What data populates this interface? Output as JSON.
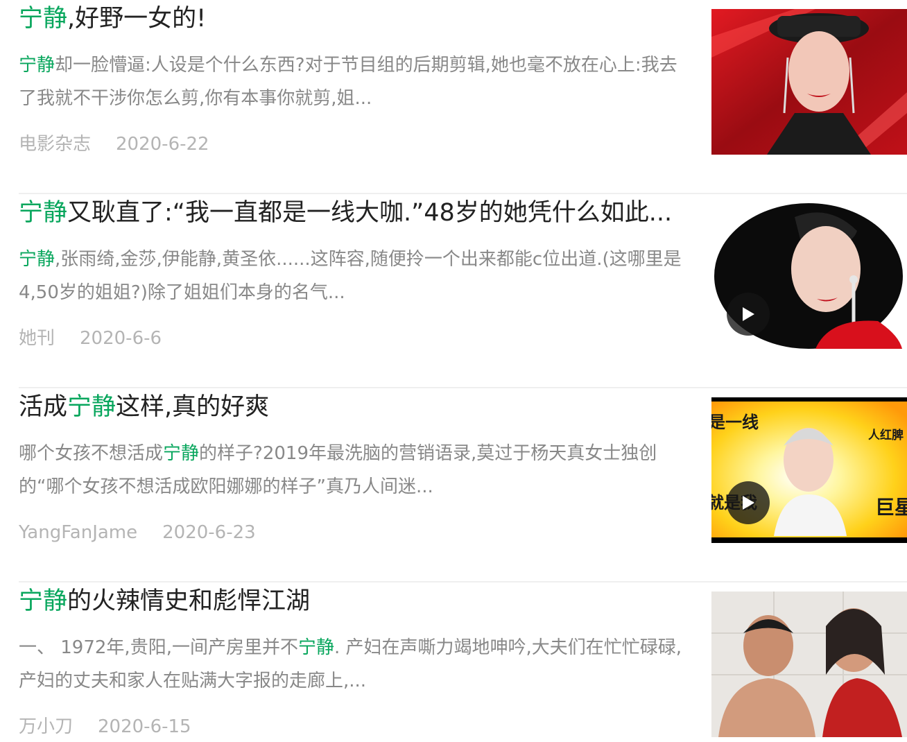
{
  "keyword": "宁静",
  "colors": {
    "highlight": "#07a65c",
    "title": "#222222",
    "summary": "#888888",
    "meta": "#b4b4b4"
  },
  "articles": [
    {
      "title": {
        "hl": "宁静",
        "rest": ",好野一女的!"
      },
      "summary": {
        "hl": "宁静",
        "rest": "却一脸懵逼:人设是个什么东西?对于节目组的后期剪辑,她也毫不放在心上:我去了我就不干涉你怎么剪,你有本事你就剪,姐..."
      },
      "source": "电影杂志",
      "date": "2020-6-22",
      "thumb": {
        "icon": "woman-red-hat-image",
        "has_video": false
      }
    },
    {
      "title": {
        "hl": "宁静",
        "rest": "又耿直了:“我一直都是一线大咖.”48岁的她凭什么如此..."
      },
      "summary": {
        "hl": "宁静",
        "rest": ",张雨绮,金莎,伊能静,黄圣依......这阵容,随便拎一个出来都能c位出道.(这哪里是4,50岁的姐姐?)除了姐姐们本身的名气..."
      },
      "source": "她刊",
      "date": "2020-6-6",
      "thumb": {
        "icon": "woman-portrait-image",
        "has_video": true
      }
    },
    {
      "title": {
        "pre": "活成",
        "hl": "宁静",
        "rest": "这样,真的好爽"
      },
      "summary": {
        "pre": "哪个女孩不想活成",
        "hl": "宁静",
        "rest": "的样子?2019年最洗脑的营销语录,莫过于杨天真女士独创的“哪个女孩不想活成欧阳娜娜的样子”真乃人间迷..."
      },
      "source": "YangFanJame",
      "date": "2020-6-23",
      "thumb": {
        "icon": "tv-show-screenshot-image",
        "has_video": true,
        "caption_top_left": "是一线",
        "caption_top_right": "人红脾",
        "caption_bottom_left": "就是我",
        "caption_bottom_right": "巨星"
      }
    },
    {
      "title": {
        "hl": "宁静",
        "rest": "的火辣情史和彪悍江湖"
      },
      "summary": {
        "pre": "一、 1972年,贵阳,一间产房里并不",
        "hl": "宁静",
        "rest": ". 产妇在声嘶力竭地呻吟,大夫们在忙忙碌碌,产妇的丈夫和家人在贴满大字报的走廊上,..."
      },
      "source": "万小刀",
      "date": "2020-6-15",
      "thumb": {
        "icon": "movie-still-image",
        "has_video": false
      }
    }
  ]
}
